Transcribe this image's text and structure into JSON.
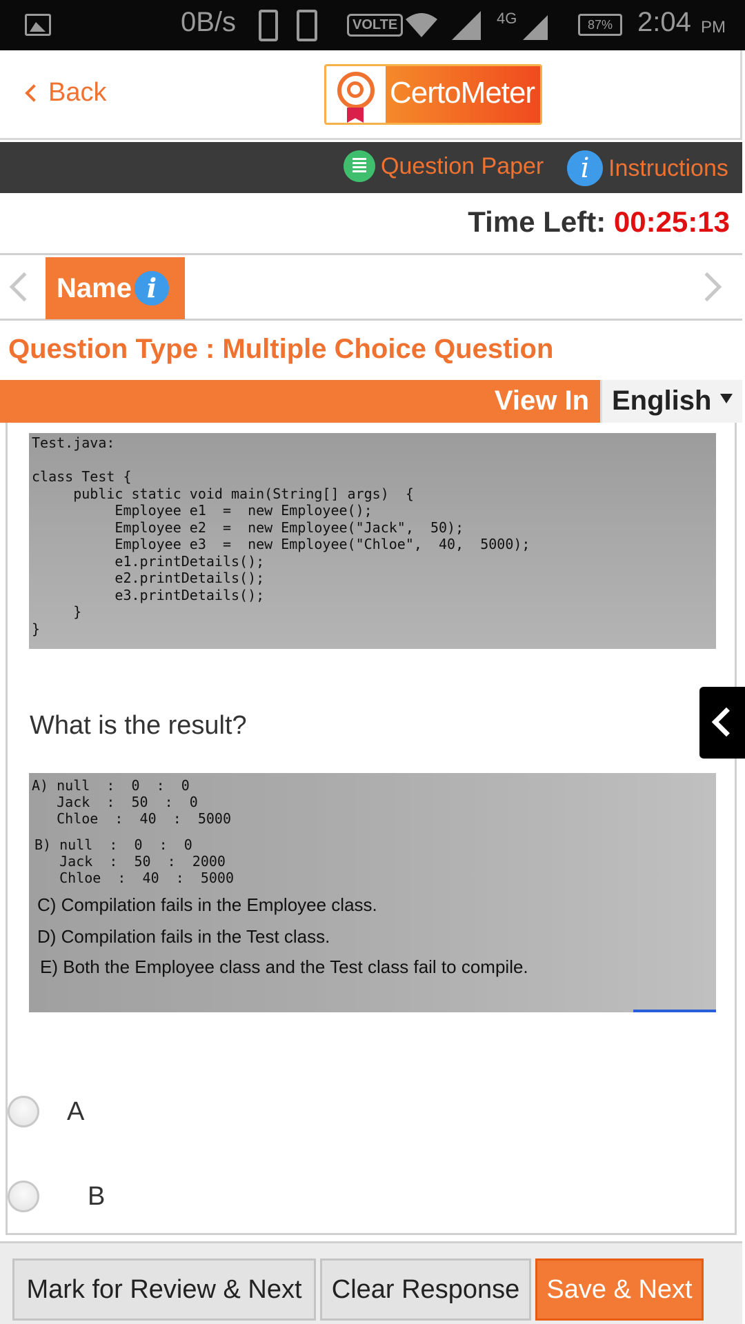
{
  "status_bar": {
    "net_speed": "0B/s",
    "volte": "VOLTE",
    "network": "4G",
    "sim1": "1",
    "sim2": "2",
    "battery": "87%",
    "time": "2:04",
    "ampm": "PM"
  },
  "header": {
    "back_label": "Back",
    "logo_text": "CertoMeter"
  },
  "nav": {
    "question_paper": "Question Paper",
    "instructions": "Instructions"
  },
  "timer": {
    "label": "Time Left:",
    "value": "00:25:13"
  },
  "section": {
    "tab_name": "Name"
  },
  "question_type": "Question Type : Multiple Choice Question",
  "view_in": {
    "label": "View In",
    "language": "English"
  },
  "code_image": {
    "lines": [
      "Test.java:",
      "",
      "class Test {",
      "     public static void main(String[] args)  {",
      "          Employee e1  =  new Employee();",
      "          Employee e2  =  new Employee(\"Jack\",  50);",
      "          Employee e3  =  new Employee(\"Chloe\",  40,  5000);",
      "          e1.printDetails();",
      "          e2.printDetails();",
      "          e3.printDetails();",
      "     }",
      "}"
    ]
  },
  "question_text": "What is the result?",
  "options_image": {
    "lines": [
      "A) null  :  0  :  0",
      "   Jack  :  50  :  0",
      "   Chloe  :  40  :  5000",
      "B) null  :  0  :  0",
      "   Jack  :  50  :  2000",
      "   Chloe  :  40  :  5000",
      "C) Compilation fails in the Employee class.",
      "D) Compilation fails in the Test class.",
      "E) Both the Employee class and the Test class fail to compile."
    ]
  },
  "choices": [
    {
      "label": "A"
    },
    {
      "label": "B"
    }
  ],
  "footer": {
    "mark_review": "Mark for Review & Next",
    "clear": "Clear Response",
    "save": "Save & Next"
  },
  "colors": {
    "accent": "#f37a35",
    "timer": "#e01010",
    "nav_bg": "#3a3a3a"
  }
}
